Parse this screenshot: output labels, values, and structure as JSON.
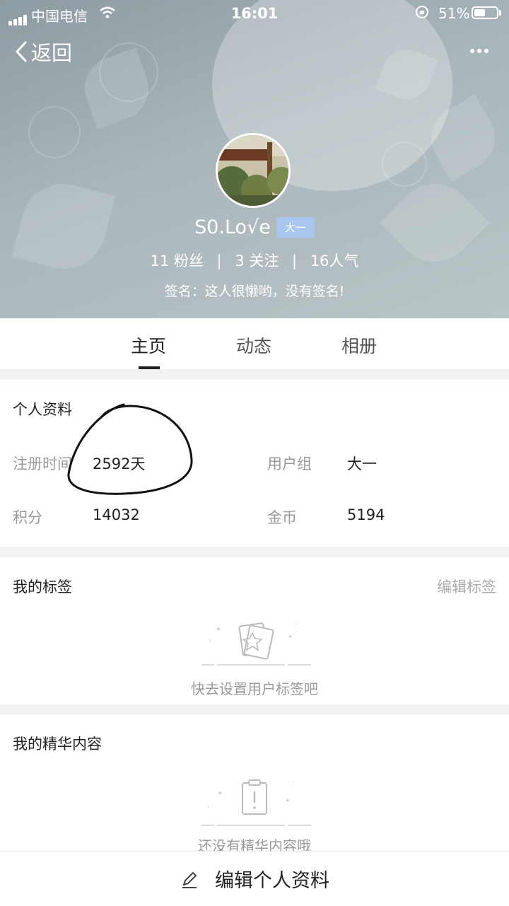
{
  "status_bar": {
    "carrier": "中国电信",
    "time": "16:01",
    "battery_percent": "51%",
    "battery_level": 0.51
  },
  "nav": {
    "back_label": "返回"
  },
  "profile": {
    "username": "S0.Lo√e",
    "grade_badge": "大一",
    "stats": {
      "fans": "11 粉丝",
      "following": "3 关注",
      "popularity": "16人气"
    },
    "signature": "签名：这人很懒哟，没有签名!"
  },
  "tabs": [
    {
      "label": "主页",
      "active": true
    },
    {
      "label": "动态",
      "active": false
    },
    {
      "label": "相册",
      "active": false
    }
  ],
  "personal_info": {
    "title": "个人资料",
    "fields": [
      {
        "label": "注册时间",
        "value": "2592天"
      },
      {
        "label": "用户组",
        "value": "大一"
      },
      {
        "label": "积分",
        "value": "14032"
      },
      {
        "label": "金币",
        "value": "5194"
      }
    ]
  },
  "tags": {
    "title": "我的标签",
    "edit_label": "编辑标签",
    "empty_text": "快去设置用户标签吧"
  },
  "essence": {
    "title": "我的精华内容",
    "empty_text": "还没有精华内容哦"
  },
  "bottom": {
    "edit_profile_label": "编辑个人资料"
  },
  "icons": [
    "wifi-icon",
    "lock-icon",
    "back-chevron-icon",
    "more-icon",
    "cards-star-icon",
    "clipboard-icon",
    "pencil-icon"
  ]
}
